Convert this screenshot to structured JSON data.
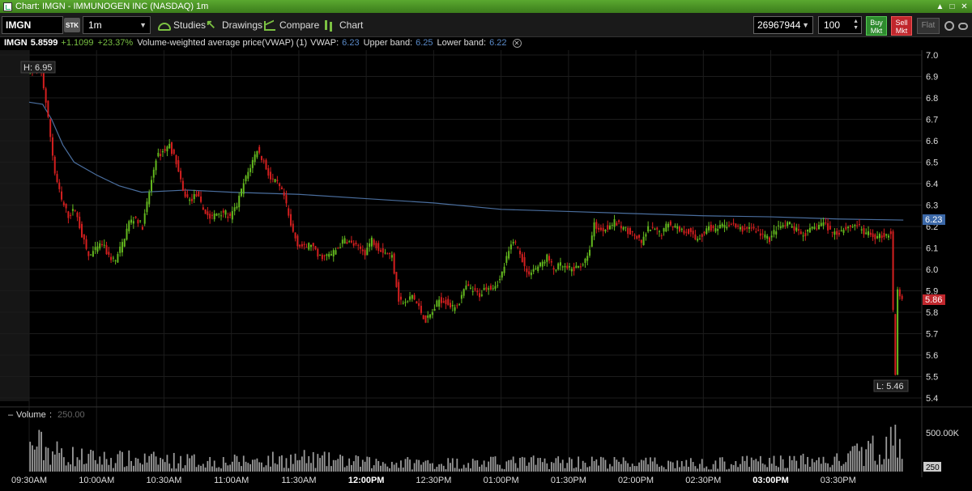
{
  "window": {
    "title": "Chart: IMGN - IMMUNOGEN INC (NASDAQ) 1m",
    "controls": [
      "pin-icon",
      "maximize-icon",
      "close-icon"
    ]
  },
  "toolbar": {
    "symbol": "IMGN",
    "security_type": "STK",
    "interval": "1m",
    "studies_label": "Studies",
    "drawings_label": "Drawings",
    "compare_label": "Compare",
    "chart_label": "Chart",
    "account": "26967944",
    "quantity": "100",
    "buy_label_1": "Buy",
    "buy_label_2": "Mkt",
    "sell_label_1": "Sell",
    "sell_label_2": "Mkt",
    "flat_label": "Flat"
  },
  "info": {
    "symbol": "IMGN",
    "last": "5.8599",
    "change": "+1.1099",
    "change_pct": "+23.37%",
    "study_name": "Volume-weighted average price(VWAP) (1)",
    "vwap_label": "VWAP:",
    "vwap_value": "6.23",
    "upper_label": "Upper band:",
    "upper_value": "6.25",
    "lower_label": "Lower band:",
    "lower_value": "6.22"
  },
  "price_pane": {
    "high_label": "H: 6.95",
    "low_label": "L: 5.46",
    "vwap_tag": "6.23",
    "last_tag": "5.86"
  },
  "volume_pane": {
    "title": "Volume",
    "value": "250.00",
    "axis_top": "500.00K",
    "axis_tag": "250"
  },
  "colors": {
    "up": "#63b81e",
    "down": "#d41f1f",
    "vwap": "#4a6e9e",
    "volume": "#9a9a9a",
    "grid": "#1c1c1c",
    "last_tag": "#c1272d",
    "vwap_tag": "#3b68a8"
  },
  "chart_data": {
    "type": "candlestick",
    "x_tick_labels": [
      "09:30AM",
      "10:00AM",
      "10:30AM",
      "11:00AM",
      "11:30AM",
      "12:00PM",
      "12:30PM",
      "01:00PM",
      "01:30PM",
      "02:00PM",
      "02:30PM",
      "03:00PM",
      "03:30PM"
    ],
    "x_tick_times": [
      570,
      600,
      630,
      660,
      690,
      720,
      750,
      780,
      810,
      840,
      870,
      900,
      930
    ],
    "x_range": [
      570,
      960
    ],
    "bold_ticks": [
      "12:00PM",
      "03:00PM"
    ],
    "y_ticks": [
      7.0,
      6.9,
      6.8,
      6.7,
      6.6,
      6.5,
      6.4,
      6.3,
      6.2,
      6.1,
      6.0,
      5.9,
      5.8,
      5.7,
      5.6,
      5.5,
      5.4
    ],
    "y_range": [
      5.4,
      7.0
    ],
    "price_path": [
      [
        570,
        6.93
      ],
      [
        576,
        6.92
      ],
      [
        578,
        6.78
      ],
      [
        580,
        6.62
      ],
      [
        582,
        6.45
      ],
      [
        585,
        6.32
      ],
      [
        588,
        6.25
      ],
      [
        591,
        6.28
      ],
      [
        594,
        6.16
      ],
      [
        597,
        6.06
      ],
      [
        600,
        6.09
      ],
      [
        603,
        6.12
      ],
      [
        606,
        6.06
      ],
      [
        609,
        6.04
      ],
      [
        612,
        6.12
      ],
      [
        615,
        6.22
      ],
      [
        618,
        6.24
      ],
      [
        621,
        6.2
      ],
      [
        624,
        6.36
      ],
      [
        627,
        6.52
      ],
      [
        630,
        6.55
      ],
      [
        633,
        6.58
      ],
      [
        636,
        6.5
      ],
      [
        639,
        6.36
      ],
      [
        642,
        6.32
      ],
      [
        645,
        6.35
      ],
      [
        648,
        6.28
      ],
      [
        651,
        6.24
      ],
      [
        654,
        6.26
      ],
      [
        657,
        6.27
      ],
      [
        660,
        6.24
      ],
      [
        663,
        6.3
      ],
      [
        666,
        6.4
      ],
      [
        669,
        6.48
      ],
      [
        672,
        6.56
      ],
      [
        675,
        6.5
      ],
      [
        678,
        6.42
      ],
      [
        681,
        6.4
      ],
      [
        684,
        6.34
      ],
      [
        687,
        6.2
      ],
      [
        690,
        6.12
      ],
      [
        693,
        6.1
      ],
      [
        696,
        6.12
      ],
      [
        699,
        6.06
      ],
      [
        702,
        6.06
      ],
      [
        705,
        6.07
      ],
      [
        708,
        6.1
      ],
      [
        711,
        6.14
      ],
      [
        714,
        6.12
      ],
      [
        717,
        6.1
      ],
      [
        720,
        6.08
      ],
      [
        723,
        6.14
      ],
      [
        726,
        6.1
      ],
      [
        729,
        6.08
      ],
      [
        732,
        6.06
      ],
      [
        735,
        5.86
      ],
      [
        738,
        5.84
      ],
      [
        741,
        5.88
      ],
      [
        744,
        5.82
      ],
      [
        747,
        5.76
      ],
      [
        750,
        5.8
      ],
      [
        753,
        5.86
      ],
      [
        756,
        5.85
      ],
      [
        759,
        5.82
      ],
      [
        762,
        5.85
      ],
      [
        765,
        5.92
      ],
      [
        768,
        5.9
      ],
      [
        771,
        5.88
      ],
      [
        774,
        5.92
      ],
      [
        777,
        5.92
      ],
      [
        780,
        5.95
      ],
      [
        783,
        6.05
      ],
      [
        786,
        6.14
      ],
      [
        789,
        6.08
      ],
      [
        792,
        5.98
      ],
      [
        795,
        6.0
      ],
      [
        798,
        6.02
      ],
      [
        801,
        6.06
      ],
      [
        804,
        6.0
      ],
      [
        807,
        6.02
      ],
      [
        810,
        6.0
      ],
      [
        813,
        6.0
      ],
      [
        816,
        6.02
      ],
      [
        819,
        6.05
      ],
      [
        822,
        6.21
      ],
      [
        825,
        6.18
      ],
      [
        828,
        6.2
      ],
      [
        831,
        6.22
      ],
      [
        834,
        6.2
      ],
      [
        837,
        6.18
      ],
      [
        840,
        6.16
      ],
      [
        843,
        6.12
      ],
      [
        846,
        6.19
      ],
      [
        849,
        6.18
      ],
      [
        852,
        6.17
      ],
      [
        855,
        6.22
      ],
      [
        858,
        6.2
      ],
      [
        861,
        6.18
      ],
      [
        864,
        6.18
      ],
      [
        867,
        6.14
      ],
      [
        870,
        6.16
      ],
      [
        873,
        6.2
      ],
      [
        876,
        6.18
      ],
      [
        879,
        6.2
      ],
      [
        882,
        6.21
      ],
      [
        885,
        6.2
      ],
      [
        888,
        6.18
      ],
      [
        891,
        6.2
      ],
      [
        894,
        6.18
      ],
      [
        897,
        6.16
      ],
      [
        900,
        6.14
      ],
      [
        903,
        6.19
      ],
      [
        906,
        6.2
      ],
      [
        909,
        6.21
      ],
      [
        912,
        6.18
      ],
      [
        915,
        6.16
      ],
      [
        918,
        6.18
      ],
      [
        921,
        6.2
      ],
      [
        924,
        6.22
      ],
      [
        927,
        6.18
      ],
      [
        930,
        6.17
      ],
      [
        933,
        6.19
      ],
      [
        936,
        6.2
      ],
      [
        939,
        6.21
      ],
      [
        942,
        6.17
      ],
      [
        945,
        6.16
      ],
      [
        948,
        6.15
      ],
      [
        951,
        6.16
      ],
      [
        954,
        6.17
      ],
      [
        955,
        5.8
      ],
      [
        956,
        5.5
      ],
      [
        957,
        5.9
      ],
      [
        959,
        5.86
      ]
    ],
    "vwap_path": [
      [
        570,
        6.78
      ],
      [
        576,
        6.77
      ],
      [
        580,
        6.7
      ],
      [
        585,
        6.58
      ],
      [
        590,
        6.5
      ],
      [
        600,
        6.44
      ],
      [
        610,
        6.39
      ],
      [
        620,
        6.36
      ],
      [
        640,
        6.37
      ],
      [
        660,
        6.36
      ],
      [
        690,
        6.35
      ],
      [
        720,
        6.33
      ],
      [
        750,
        6.31
      ],
      [
        780,
        6.28
      ],
      [
        810,
        6.27
      ],
      [
        840,
        6.26
      ],
      [
        870,
        6.25
      ],
      [
        900,
        6.245
      ],
      [
        930,
        6.235
      ],
      [
        959,
        6.23
      ]
    ],
    "volume_profile": [
      [
        570,
        0.45
      ],
      [
        572,
        0.55
      ],
      [
        575,
        0.5
      ],
      [
        580,
        0.4
      ],
      [
        590,
        0.3
      ],
      [
        600,
        0.26
      ],
      [
        620,
        0.24
      ],
      [
        640,
        0.22
      ],
      [
        660,
        0.2
      ],
      [
        690,
        0.26
      ],
      [
        720,
        0.18
      ],
      [
        750,
        0.17
      ],
      [
        780,
        0.18
      ],
      [
        810,
        0.2
      ],
      [
        840,
        0.17
      ],
      [
        870,
        0.16
      ],
      [
        900,
        0.2
      ],
      [
        930,
        0.22
      ],
      [
        955,
        0.6
      ],
      [
        959,
        0.3
      ]
    ]
  }
}
